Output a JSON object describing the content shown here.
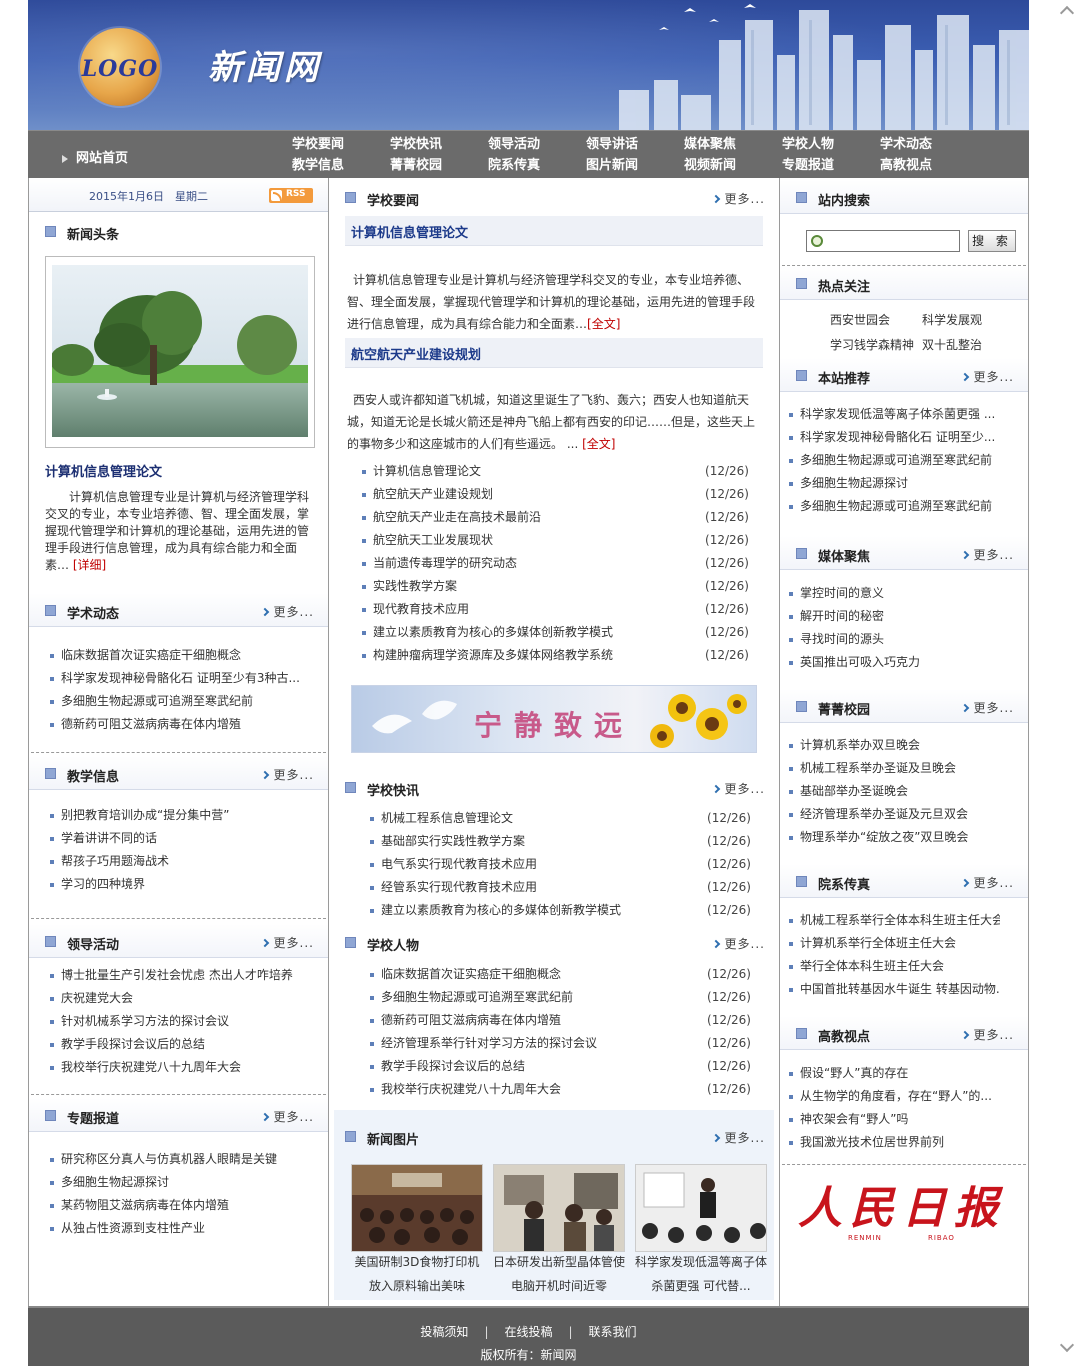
{
  "header": {
    "logo_text": "LOGO",
    "site_title": "新闻网"
  },
  "nav": {
    "home": "网站首页",
    "items": [
      "学校要闻",
      "学校快讯",
      "领导活动",
      "领导讲话",
      "媒体聚焦",
      "学校人物",
      "学术动态",
      "教学信息",
      "菁菁校园",
      "院系传真",
      "图片新闻",
      "视频新闻",
      "专题报道",
      "高教视点"
    ]
  },
  "left": {
    "date": "2015年1月6日　星期二",
    "rss": "RSS",
    "headline_section": "新闻头条",
    "feature_title": "计算机信息管理论文",
    "feature_body": "计算机信息管理专业是计算机与经济管理学科交叉的专业，本专业培养德、智、理全面发展，掌握现代管理学和计算机的理论基础，运用先进的管理手段进行信息管理，成为具有综合能力和全面素…",
    "feature_more": "[详细]",
    "more": "更多...",
    "sections": [
      {
        "title": "学术动态",
        "items": [
          "临床数据首次证实癌症干细胞概念",
          "科学家发现神秘骨骼化石 证明至少有3种古...",
          "多细胞生物起源或可追溯至寒武纪前",
          "德新药可阻艾滋病病毒在体内增殖"
        ]
      },
      {
        "title": "教学信息",
        "items": [
          "别把教育培训办成“提分集中营”",
          "学着讲讲不同的话",
          "帮孩子巧用题海战术",
          "学习的四种境界"
        ]
      },
      {
        "title": "领导活动",
        "items": [
          "博士批量生产引发社会忧虑 杰出人才咋培养",
          "庆祝建党大会",
          "针对机械系学习方法的探讨会议",
          "教学手段探讨会议后的总结",
          "我校举行庆祝建党八十九周年大会"
        ]
      },
      {
        "title": "专题报道",
        "items": [
          "研究称区分真人与仿真机器人眼睛是关键",
          "多细胞生物起源探讨",
          "某药物阻艾滋病病毒在体内增殖",
          "从独占性资源到支柱性产业"
        ]
      }
    ]
  },
  "middle": {
    "more": "更多...",
    "yaowen": {
      "title": "学校要闻",
      "art1_title": "计算机信息管理论文",
      "art1_body": "计算机信息管理专业是计算机与经济管理学科交叉的专业，本专业培养德、智、理全面发展，掌握现代管理学和计算机的理论基础，运用先进的管理手段进行信息管理，成为具有综合能力和全面素…",
      "art2_title": "航空航天产业建设规划",
      "art2_body": "西安人或许都知道飞机城，知道这里诞生了飞豹、轰六；西安人也知道航天城，知道无论是长城火箭还是神舟飞船上都有西安的印记……但是，这些天上的事物多少和这座城市的人们有些遥远。 ...",
      "fulltext": "[全文]",
      "items": [
        {
          "t": "计算机信息管理论文",
          "d": "(12/26)"
        },
        {
          "t": "航空航天产业建设规划",
          "d": "(12/26)"
        },
        {
          "t": "航空航天产业走在高技术最前沿",
          "d": "(12/26)"
        },
        {
          "t": "航空航天工业发展现状",
          "d": "(12/26)"
        },
        {
          "t": "当前遗传毒理学的研究动态",
          "d": "(12/26)"
        },
        {
          "t": "实践性教学方案",
          "d": "(12/26)"
        },
        {
          "t": "现代教育技术应用",
          "d": "(12/26)"
        },
        {
          "t": "建立以素质教育为核心的多媒体创新教学模式",
          "d": "(12/26)"
        },
        {
          "t": "构建肿瘤病理学资源库及多媒体网络教学系统",
          "d": "(12/26)"
        }
      ]
    },
    "banner_text": "宁静致远",
    "kuaixun": {
      "title": "学校快讯",
      "items": [
        {
          "t": "机械工程系信息管理论文",
          "d": "(12/26)"
        },
        {
          "t": "基础部实行实践性教学方案",
          "d": "(12/26)"
        },
        {
          "t": "电气系实行现代教育技术应用",
          "d": "(12/26)"
        },
        {
          "t": "经管系实行现代教育技术应用",
          "d": "(12/26)"
        },
        {
          "t": "建立以素质教育为核心的多媒体创新教学模式",
          "d": "(12/26)"
        }
      ]
    },
    "renwu": {
      "title": "学校人物",
      "items": [
        {
          "t": "临床数据首次证实癌症干细胞概念",
          "d": "(12/26)"
        },
        {
          "t": "多细胞生物起源或可追溯至寒武纪前",
          "d": "(12/26)"
        },
        {
          "t": "德新药可阻艾滋病病毒在体内增殖",
          "d": "(12/26)"
        },
        {
          "t": "经济管理系举行针对学习方法的探讨会议",
          "d": "(12/26)"
        },
        {
          "t": "教学手段探讨会议后的总结",
          "d": "(12/26)"
        },
        {
          "t": "我校举行庆祝建党八十九周年大会",
          "d": "(12/26)"
        }
      ]
    },
    "pics": {
      "title": "新闻图片",
      "captions": [
        "美国研制3D食物打印机放入原料输出美味",
        "日本研发出新型晶体管使电脑开机时间近零",
        "科学家发现低温等离子体杀菌更强 可代替..."
      ]
    }
  },
  "right": {
    "more": "更多...",
    "search": {
      "title": "站内搜索",
      "placeholder": "",
      "button": "搜 索"
    },
    "hot": {
      "title": "热点关注",
      "items": [
        "西安世园会",
        "科学发展观",
        "学习钱学森精神",
        "双十乱整治"
      ]
    },
    "sections": [
      {
        "title": "本站推荐",
        "items": [
          "科学家发现低温等离子体杀菌更强 ...",
          "科学家发现神秘骨骼化石 证明至少...",
          "多细胞生物起源或可追溯至寒武纪前",
          "多细胞生物起源探讨",
          "多细胞生物起源或可追溯至寒武纪前"
        ]
      },
      {
        "title": "媒体聚焦",
        "items": [
          "掌控时间的意义",
          "解开时间的秘密",
          "寻找时间的源头",
          "英国推出可吸入巧克力"
        ]
      },
      {
        "title": "菁菁校园",
        "items": [
          "计算机系举办双旦晚会",
          "机械工程系举办圣诞及旦晚会",
          "基础部举办圣诞晚会",
          "经济管理系举办圣诞及元旦双会",
          "物理系举办“绽放之夜”双旦晚会"
        ]
      },
      {
        "title": "院系传真",
        "items": [
          "机械工程系举行全体本科生班主任大会",
          "计算机系举行全体班主任大会",
          "举行全体本科生班主任大会",
          "中国首批转基因水牛诞生 转基因动物..."
        ]
      },
      {
        "title": "高教视点",
        "items": [
          "假设“野人”真的存在",
          "从生物学的角度看，存在“野人”的...",
          "神农架会有“野人”吗",
          "我国激光技术位居世界前列"
        ]
      }
    ],
    "renmin_cn": "人民日报",
    "renmin_en1": "RENMIN",
    "renmin_en2": "RIBAO"
  },
  "footer": {
    "links": [
      "投稿须知",
      "在线投稿",
      "联系我们"
    ],
    "copyright": "版权所有：新闻网"
  },
  "colors": {
    "nav_bg": "#6b6b6b",
    "banner_blue": "#3c5fb3",
    "title_blue": "#1c2f72",
    "red": "#c00000"
  }
}
